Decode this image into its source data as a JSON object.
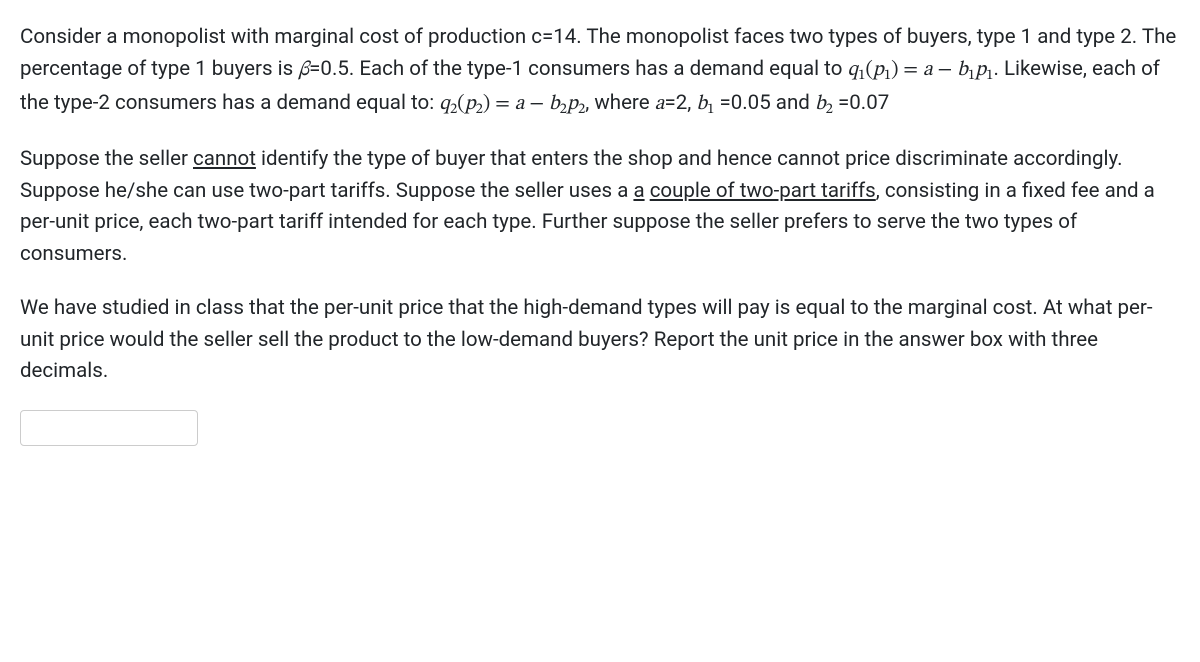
{
  "para1": {
    "t1": "Consider a monopolist with marginal cost of production c=14. The monopolist faces two types of buyers, type 1 and type 2. The percentage of type 1 buyers is ",
    "beta": "β",
    "t2": "=0.5. Each of the type-1 consumers has a demand equal to ",
    "eq1_q": "q",
    "eq1_qs": "1",
    "eq1_lp": "(",
    "eq1_p": "p",
    "eq1_ps": "1",
    "eq1_rp": ")",
    "eq1_eq": " = ",
    "eq1_a": "a",
    "eq1_min": " − ",
    "eq1_b": "b",
    "eq1_bs": "1",
    "eq1_p2": "p",
    "eq1_p2s": "1",
    "t3": ". Likewise, each of the type-2 consumers has a demand equal to: ",
    "eq2_q": "q",
    "eq2_qs": "2",
    "eq2_lp": "(",
    "eq2_p": "p",
    "eq2_ps": "2",
    "eq2_rp": ")",
    "eq2_eq": " = ",
    "eq2_a": "a",
    "eq2_min": " − ",
    "eq2_b": "b",
    "eq2_bs": "2",
    "eq2_p2": "p",
    "eq2_p2s": "2",
    "t4": ", where ",
    "a_eq": "a",
    "a_val": "=2, ",
    "b1": "b",
    "b1s": "1",
    "b1_val": " =0.05 and ",
    "b2": "b",
    "b2s": "2",
    "b2_val": " =0.07"
  },
  "para2": {
    "t1": "Suppose the seller ",
    "u1": "cannot",
    "t2": " identify the type of buyer that enters the shop and hence cannot price discriminate accordingly. Suppose he/she can use two-part tariffs. Suppose the seller uses a ",
    "u2a": "a",
    "sp": " ",
    "u2b": "couple of two-part tariffs",
    "t3": ", consisting in a fixed fee and a per-unit price, each two-part tariff intended for each type. Further suppose the seller prefers to serve the two types of consumers."
  },
  "para3": "We have studied in class that the per-unit price that the high-demand types will pay is equal to the marginal cost. At what per-unit price would the seller sell the product to the low-demand buyers? Report the unit price in the answer box with three decimals.",
  "answer_value": ""
}
